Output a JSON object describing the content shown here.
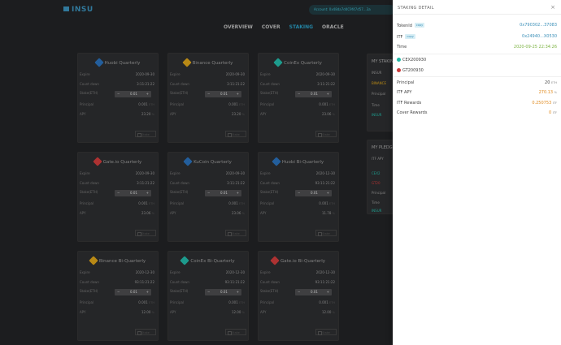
{
  "app": {
    "logo": "INSU",
    "address": "Account: 0x48da7d4C9f47d57...3a"
  },
  "nav": [
    {
      "label": "OVERVIEW"
    },
    {
      "label": "COVER"
    },
    {
      "label": "STAKING"
    },
    {
      "label": "ORACLE"
    }
  ],
  "labels": {
    "expire": "Expire",
    "countdown": "Count down",
    "stake": "Stake(ETH)",
    "principal": "Principal",
    "apy": "APY",
    "stake_btn": "Stake",
    "eth": "ETH",
    "pct": "%"
  },
  "cards": [
    {
      "title": "Huobi Quarterly",
      "icon": "huobi-icon",
      "color": "#2a6fb8",
      "expire": "2020-09-30",
      "countdown": "3:11:21:22",
      "stake": "0.01",
      "principal": "0.001",
      "apy": "23.20"
    },
    {
      "title": "Binance Quarterly",
      "icon": "binance-icon",
      "color": "#d9a219",
      "expire": "2020-09-30",
      "countdown": "3:11:21:22",
      "stake": "0.01",
      "principal": "0.001",
      "apy": "23.20"
    },
    {
      "title": "CoinEx Quarterly",
      "icon": "coinex-icon",
      "color": "#23b7a6",
      "expire": "2020-09-30",
      "countdown": "3:11:21:22",
      "stake": "0.01",
      "principal": "0.001",
      "apy": "23.06"
    },
    {
      "title": "Gate.io Quarterly",
      "icon": "gateio-icon",
      "color": "#cc3b3b",
      "expire": "2020-09-30",
      "countdown": "3:11:21:22",
      "stake": "0.01",
      "principal": "0.001",
      "apy": "23.06"
    },
    {
      "title": "KuCoin Quarterly",
      "icon": "kucoin-icon",
      "color": "#2a6fb8",
      "expire": "2020-09-30",
      "countdown": "3:11:21:22",
      "stake": "0.01",
      "principal": "0.001",
      "apy": "23.06"
    },
    {
      "title": "Huobi Bi-Quarterly",
      "icon": "huobi-icon",
      "color": "#2a6fb8",
      "expire": "2020-12-30",
      "countdown": "93:11:21:22",
      "stake": "0.01",
      "principal": "0.001",
      "apy": "11.78"
    },
    {
      "title": "Binance Bi-Quarterly",
      "icon": "binance-icon",
      "color": "#d9a219",
      "expire": "2020-12-30",
      "countdown": "93:11:21:22",
      "stake": "0.01",
      "principal": "0.001",
      "apy": "12.00"
    },
    {
      "title": "CoinEx Bi-Quarterly",
      "icon": "coinex-icon",
      "color": "#23b7a6",
      "expire": "2020-12-30",
      "countdown": "93:11:21:22",
      "stake": "0.01",
      "principal": "0.001",
      "apy": "12.00"
    },
    {
      "title": "Gate.io Bi-Quarterly",
      "icon": "gateio-icon",
      "color": "#cc3b3b",
      "expire": "2020-12-30",
      "countdown": "93:11:21:22",
      "stake": "0.01",
      "principal": "0.001",
      "apy": "12.00"
    }
  ],
  "side": {
    "my_staking": "MY STAKING",
    "my_pledge": "MY PLEDGE",
    "insur": "INSUR",
    "itf_apy": "ITF APY",
    "principal": "Principal",
    "time": "Time",
    "binance": "BINANCE",
    "cex": "CEX2",
    "gtx": "GT20"
  },
  "drawer": {
    "title": "STAKING DETAIL",
    "close": "×",
    "tokenid_label": "TokenId",
    "tokenid_badge": "copy",
    "tokenid": "0x790302...37083",
    "itf_label": "ITF",
    "itf_badge": "copy",
    "itf": "0x24940...X0530",
    "time_label": "Time",
    "time": "2020-09-25 22:34:26",
    "chip1": "CEX200930",
    "chip2": "GT200930",
    "principal_label": "Principal",
    "principal": "20",
    "principal_unit": "ETH",
    "itfapy_label": "ITF APY",
    "itfapy": "270.13",
    "itfapy_unit": "%",
    "itfrewards_label": "ITF Rewards",
    "itfrewards": "0.250753",
    "itfrewards_unit": "ITF",
    "coverrewards_label": "Cover Rewards",
    "coverrewards": "0",
    "coverrewards_unit": "ITF"
  }
}
